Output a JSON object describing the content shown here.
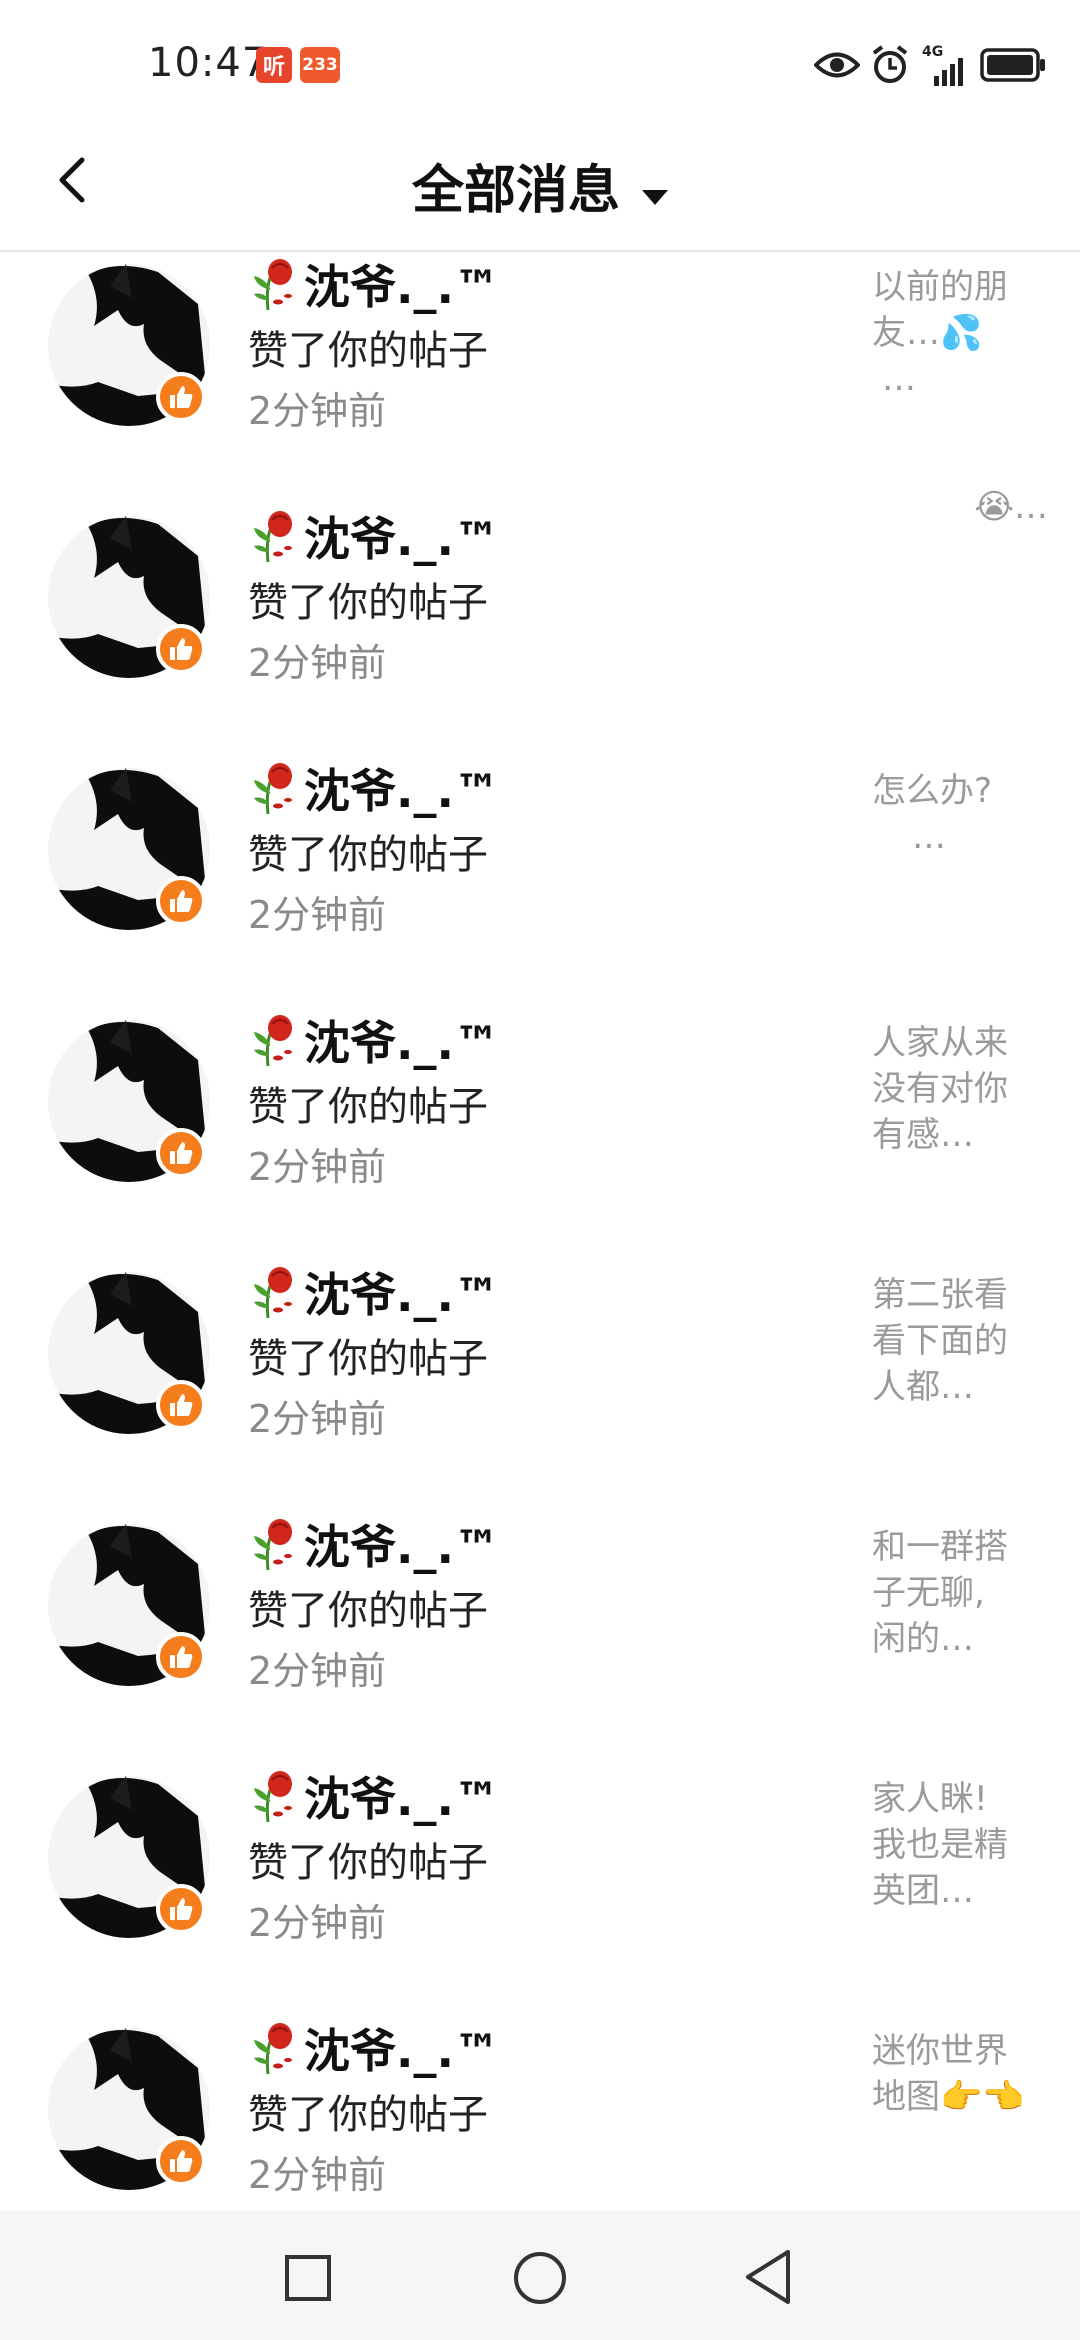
{
  "status_bar": {
    "time": "10:47",
    "badge_ting": "听",
    "badge_233": "233",
    "network": "4G"
  },
  "header": {
    "title": "全部消息"
  },
  "notifications": [
    {
      "user": "沈爷._.™",
      "action": "赞了你的帖子",
      "time": "2分钟前",
      "preview": [
        "以前的朋",
        "友…💦",
        "…"
      ]
    },
    {
      "user": "沈爷._.™",
      "action": "赞了你的帖子",
      "time": "2分钟前",
      "preview": [
        "",
        "😭…",
        ""
      ]
    },
    {
      "user": "沈爷._.™",
      "action": "赞了你的帖子",
      "time": "2分钟前",
      "preview": [
        "怎么办?",
        "…",
        ""
      ]
    },
    {
      "user": "沈爷._.™",
      "action": "赞了你的帖子",
      "time": "2分钟前",
      "preview": [
        "人家从来",
        "没有对你",
        "有感…"
      ]
    },
    {
      "user": "沈爷._.™",
      "action": "赞了你的帖子",
      "time": "2分钟前",
      "preview": [
        "第二张看",
        "看下面的",
        "人都…"
      ]
    },
    {
      "user": "沈爷._.™",
      "action": "赞了你的帖子",
      "time": "2分钟前",
      "preview": [
        "和一群搭",
        "子无聊,",
        "闲的…"
      ]
    },
    {
      "user": "沈爷._.™",
      "action": "赞了你的帖子",
      "time": "2分钟前",
      "preview": [
        "家人眯!",
        "我也是精",
        "英团…"
      ]
    },
    {
      "user": "沈爷._.™",
      "action": "赞了你的帖子",
      "time": "2分钟前",
      "preview": [
        "迷你世界",
        "地图👉👈",
        ""
      ]
    }
  ],
  "icons": {
    "back": "chevron-left-icon",
    "dropdown": "caret-down-icon",
    "like": "thumbs-up-icon",
    "rose": "wilted-rose-icon",
    "nav_recents": "square-icon",
    "nav_home": "circle-icon",
    "nav_back": "triangle-back-icon"
  },
  "colors": {
    "like_badge": "#f67d1b",
    "badge_red": "#e6452b",
    "preview_text": "#9a9a9a",
    "time_text": "#8a8a8a"
  }
}
